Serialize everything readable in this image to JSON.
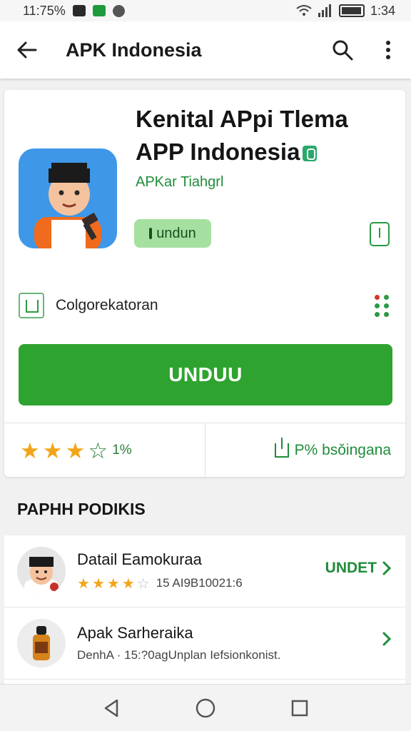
{
  "status_bar": {
    "time_left": "11:75%",
    "time_right": "1:34"
  },
  "app_bar": {
    "title": "APK Indonesia"
  },
  "app": {
    "title": "Kenital APpi Tlema APP Indonesia",
    "developer": "APKar Tiahgrl",
    "chip_label": "undun",
    "category": "Colgorekatoran",
    "install_label": "UNDUU",
    "rating_value": "1%",
    "rating_stars": 3,
    "share_label": "P% bsǒingana"
  },
  "section": {
    "title": "PAPHH PODIKIS"
  },
  "list": [
    {
      "title": "Datail Eamokuraa",
      "subtitle": "15 AI9B10021:6",
      "stars": 3.5,
      "action": "UNDET",
      "icon": "man-avatar-icon"
    },
    {
      "title": "Apak Sarheraika",
      "subtitle": "DenhA · 15:?0agUnplan Iefsionkonist.",
      "action": "",
      "icon": "bottle-avatar-icon"
    }
  ],
  "colors": {
    "accent": "#2ea32f",
    "chip_bg": "#a6e0a0",
    "star": "#f2a51a",
    "icon_bg": "#3f97e8"
  }
}
